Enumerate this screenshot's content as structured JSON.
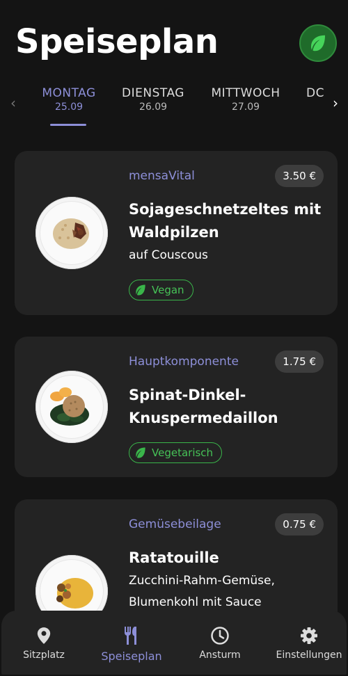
{
  "header": {
    "title": "Speiseplan",
    "filter_icon": "leaf-icon"
  },
  "days": [
    {
      "name": "MONTAG",
      "date": "25.09",
      "active": true
    },
    {
      "name": "DIENSTAG",
      "date": "26.09",
      "active": false
    },
    {
      "name": "MITTWOCH",
      "date": "27.09",
      "active": false
    },
    {
      "name": "DC",
      "date": "",
      "active": false
    }
  ],
  "meals": [
    {
      "category": "mensaVital",
      "price": "3.50 €",
      "dish": "Sojageschnetzeltes mit Waldpilzen",
      "side": "auf Couscous",
      "tag": "Vegan"
    },
    {
      "category": "Hauptkomponente",
      "price": "1.75 €",
      "dish": "Spinat-Dinkel-Knuspermedaillon",
      "side": "",
      "tag": "Vegetarisch"
    },
    {
      "category": "Gemüsebeilage",
      "price": "0.75 €",
      "dish": "Ratatouille",
      "side": "Zucchini-Rahm-Gemüse, Blumenkohl mit Sauce",
      "tag": ""
    }
  ],
  "bottom_nav": [
    {
      "label": "Sitzplatz",
      "icon": "location-pin-icon",
      "active": false
    },
    {
      "label": "Speiseplan",
      "icon": "fork-knife-icon",
      "active": true
    },
    {
      "label": "Ansturm",
      "icon": "clock-icon",
      "active": false
    },
    {
      "label": "Einstellungen",
      "icon": "gear-icon",
      "active": false
    }
  ],
  "colors": {
    "accent": "#8d8fd8",
    "vegan_green": "#3ab54a",
    "card_bg": "#232323",
    "background": "#141414"
  }
}
